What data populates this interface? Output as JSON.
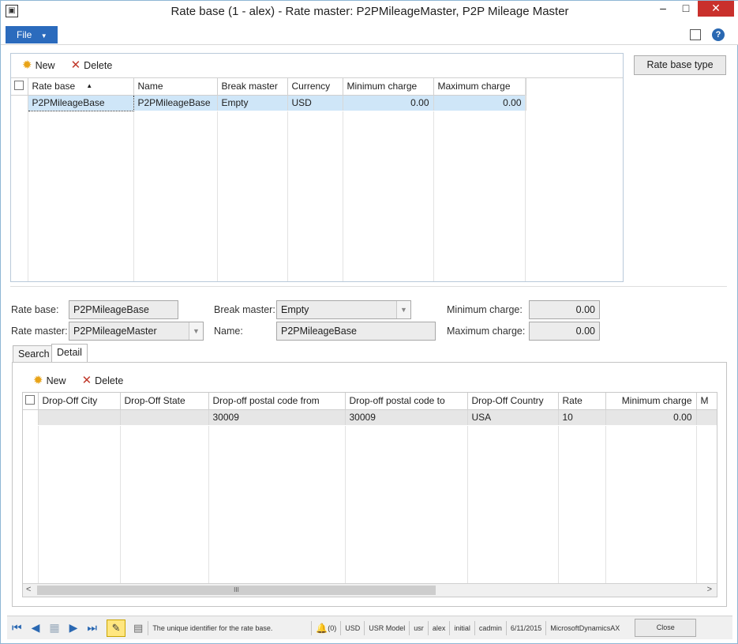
{
  "window": {
    "title": "Rate base (1 - alex) - Rate master: P2PMileageMaster, P2P Mileage Master",
    "minimize_glyph": "‒",
    "maximize_glyph": "□",
    "close_glyph": "✕",
    "app_icon": "ax-app-icon"
  },
  "menubar": {
    "file_label": "File",
    "icons": [
      "layout-icon",
      "help-icon"
    ]
  },
  "top_toolbar": {
    "new_label": "New",
    "delete_label": "Delete",
    "side_button_label": "Rate base type"
  },
  "top_grid": {
    "columns": [
      "Rate base",
      "Name",
      "Break master",
      "Currency",
      "Minimum charge",
      "Maximum charge"
    ],
    "sort_glyph": "▲",
    "rows": [
      [
        "P2PMileageBase",
        "P2PMileageBase",
        "Empty",
        "USD",
        "0.00",
        "0.00"
      ]
    ]
  },
  "form": {
    "rate_base_label": "Rate base:",
    "rate_base_value": "P2PMileageBase",
    "rate_master_label": "Rate master:",
    "rate_master_value": "P2PMileageMaster",
    "break_master_label": "Break master:",
    "break_master_value": "Empty",
    "name_label": "Name:",
    "name_value": "P2PMileageBase",
    "min_charge_label": "Minimum charge:",
    "min_charge_value": "0.00",
    "max_charge_label": "Maximum charge:",
    "max_charge_value": "0.00"
  },
  "tabs": {
    "search_label": "Search",
    "detail_label": "Detail",
    "active": "Detail"
  },
  "detail_toolbar": {
    "new_label": "New",
    "delete_label": "Delete"
  },
  "detail_grid": {
    "columns": [
      "Drop-Off City",
      "Drop-Off State",
      "Drop-off postal code from",
      "Drop-off postal code to",
      "Drop-Off Country",
      "Rate",
      "Minimum charge",
      "M"
    ],
    "rows": [
      [
        "",
        "",
        "30009",
        "30009",
        "USA",
        "10",
        "0.00",
        ""
      ]
    ],
    "scroll_left": "<",
    "scroll_right": ">",
    "scroll_thumb": "III"
  },
  "statusbar": {
    "help_text": "The unique identifier for the rate base.",
    "notifications": "(0)",
    "currency": "USD",
    "model": "USR Model",
    "layer": "usr",
    "user": "alex",
    "partition": "initial",
    "company": "cadmin",
    "date": "6/11/2015",
    "database": "MicrosoftDynamicsAX",
    "close_label": "Close"
  },
  "colors": {
    "accent": "#2b6bbd",
    "selected_row": "#cfe6f8",
    "close_button": "#c9302c"
  }
}
